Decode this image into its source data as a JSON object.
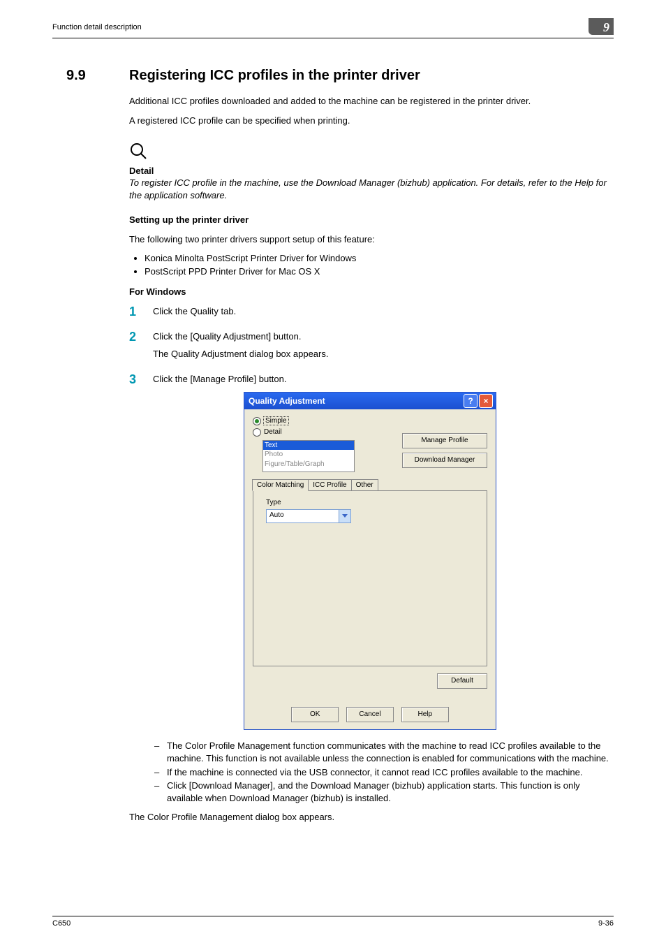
{
  "header": {
    "left": "Function detail description",
    "badge": "9"
  },
  "section": {
    "number": "9.9",
    "title": "Registering ICC profiles in the printer driver"
  },
  "intro1": "Additional ICC profiles downloaded and added to the machine can be registered in the printer driver.",
  "intro2": "A registered ICC profile can be specified when printing.",
  "detail": {
    "label": "Detail",
    "text": "To register ICC profile in the machine, use the Download Manager (bizhub) application. For details, refer to the Help for the application software."
  },
  "setup_title": "Setting up the printer driver",
  "setup_intro": "The following two printer drivers support setup of this feature:",
  "drivers": [
    "Konica Minolta PostScript Printer Driver for Windows",
    "PostScript PPD Printer Driver for Mac OS X"
  ],
  "windows_title": "For Windows",
  "steps": [
    {
      "n": "1",
      "lines": [
        "Click the Quality tab."
      ]
    },
    {
      "n": "2",
      "lines": [
        "Click the [Quality Adjustment] button.",
        "The Quality Adjustment dialog box appears."
      ]
    },
    {
      "n": "3",
      "lines": [
        "Click the [Manage Profile] button."
      ]
    }
  ],
  "dialog": {
    "title": "Quality Adjustment",
    "radios": {
      "simple": "Simple",
      "detail": "Detail"
    },
    "categories": [
      "Text",
      "Photo",
      "Figure/Table/Graph"
    ],
    "tabs": [
      "Color Matching",
      "ICC Profile",
      "Other"
    ],
    "type_label": "Type",
    "type_value": "Auto",
    "manage_btn": "Manage Profile",
    "download_btn": "Download Manager",
    "default_btn": "Default",
    "ok": "OK",
    "cancel": "Cancel",
    "help": "Help"
  },
  "notes": [
    "The Color Profile Management function communicates with the machine to read ICC profiles available to the machine. This function is not available unless the connection is enabled for communications with the machine.",
    "If the machine is connected via the USB connector, it cannot read ICC profiles available to the machine.",
    "Click [Download Manager], and the Download Manager (bizhub) application starts. This function is only available when Download Manager (bizhub) is installed."
  ],
  "after_notes": "The Color Profile Management dialog box appears.",
  "footer": {
    "left": "C650",
    "right": "9-36"
  }
}
